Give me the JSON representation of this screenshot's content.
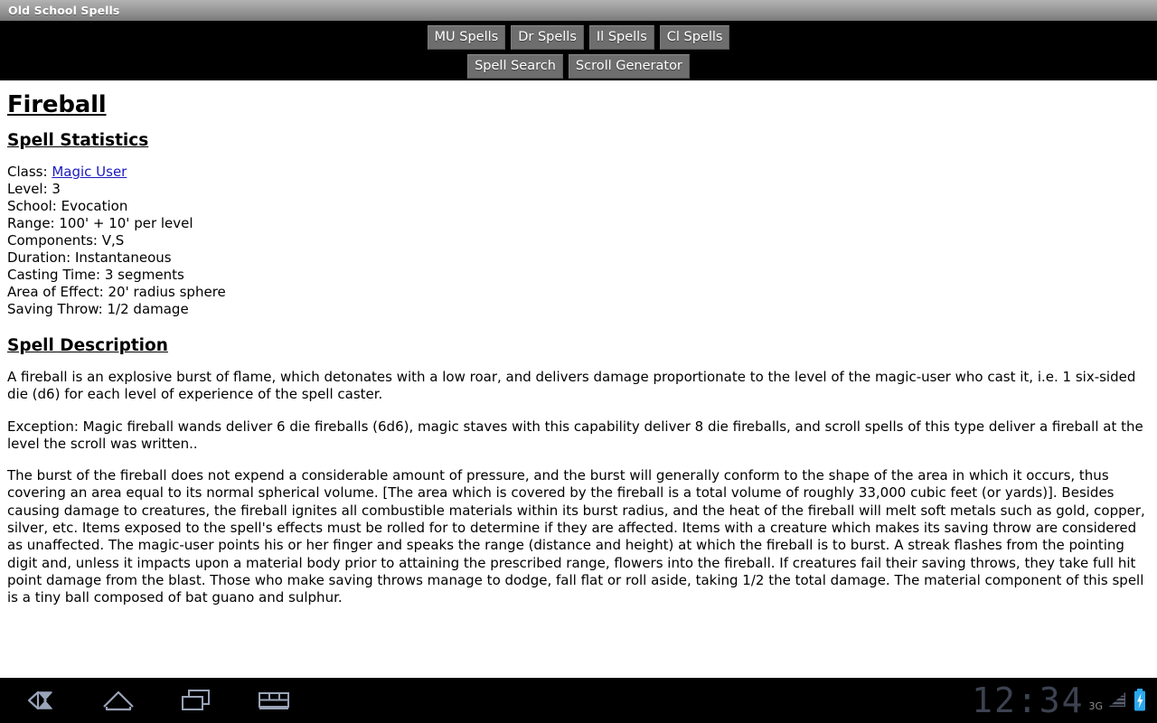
{
  "window": {
    "title": "Old School Spells"
  },
  "nav": {
    "row1": [
      {
        "label": "MU Spells",
        "name": "mu-spells-button"
      },
      {
        "label": "Dr Spells",
        "name": "dr-spells-button"
      },
      {
        "label": "Il Spells",
        "name": "il-spells-button"
      },
      {
        "label": "Cl Spells",
        "name": "cl-spells-button"
      }
    ],
    "row2": [
      {
        "label": "Spell Search",
        "name": "spell-search-button"
      },
      {
        "label": "Scroll Generator",
        "name": "scroll-generator-button"
      }
    ]
  },
  "page": {
    "spell_name": "Fireball",
    "statistics_heading": "Spell Statistics",
    "description_heading": "Spell Description",
    "stats": {
      "class_label": "Class:",
      "class_value": "Magic User",
      "level": "Level: 3",
      "school": "School: Evocation",
      "range": "Range: 100' + 10' per level",
      "components": "Components: V,S",
      "duration": "Duration: Instantaneous",
      "casting_time": "Casting Time: 3 segments",
      "area_of_effect": "Area of Effect: 20' radius sphere",
      "saving_throw": "Saving Throw: 1/2 damage"
    },
    "description": [
      "A fireball is an explosive burst of flame, which detonates with a low roar, and delivers damage proportionate to the level of the magic-user who cast it, i.e. 1 six-sided die (d6) for each level of experience of the spell caster.",
      "Exception: Magic fireball wands deliver 6 die fireballs (6d6), magic staves with this capability deliver 8 die fireballs, and scroll spells of this type deliver a fireball at the level the scroll was written..",
      "The burst of the fireball does not expend a considerable amount of pressure, and the burst will generally conform to the shape of the area in which it occurs, thus covering an area equal to its normal spherical volume. [The area which is covered by the fireball is a total volume of roughly 33,000 cubic feet (or yards)]. Besides causing damage to creatures, the fireball ignites all combustible materials within its burst radius, and the heat of the fireball will melt soft metals such as gold, copper, silver, etc. Items exposed to the spell's effects must be rolled for to determine if they are affected. Items with a creature which makes its saving throw are considered as unaffected. The magic-user points his or her finger and speaks the range (distance and height) at which the fireball is to burst. A streak flashes from the pointing digit and, unless it impacts upon a material body prior to attaining the prescribed range, flowers into the fireball. If creatures fail their saving throws, they take full hit point damage from the blast. Those who make saving throws manage to dodge, fall flat or roll aside, taking 1/2 the total damage. The material component of this spell is a tiny ball composed of bat guano and sulphur."
    ]
  },
  "systembar": {
    "buttons": [
      {
        "name": "back-icon",
        "label": "back"
      },
      {
        "name": "home-icon",
        "label": "home"
      },
      {
        "name": "recents-icon",
        "label": "recent apps"
      },
      {
        "name": "keyboard-icon",
        "label": "keyboard"
      }
    ],
    "clock": "12:34",
    "network": "3G",
    "signal_icon": "signal-bars-icon",
    "battery_icon": "battery-charging-icon",
    "clock_color": "#3c4250",
    "battery_color": "#29aaf0"
  }
}
